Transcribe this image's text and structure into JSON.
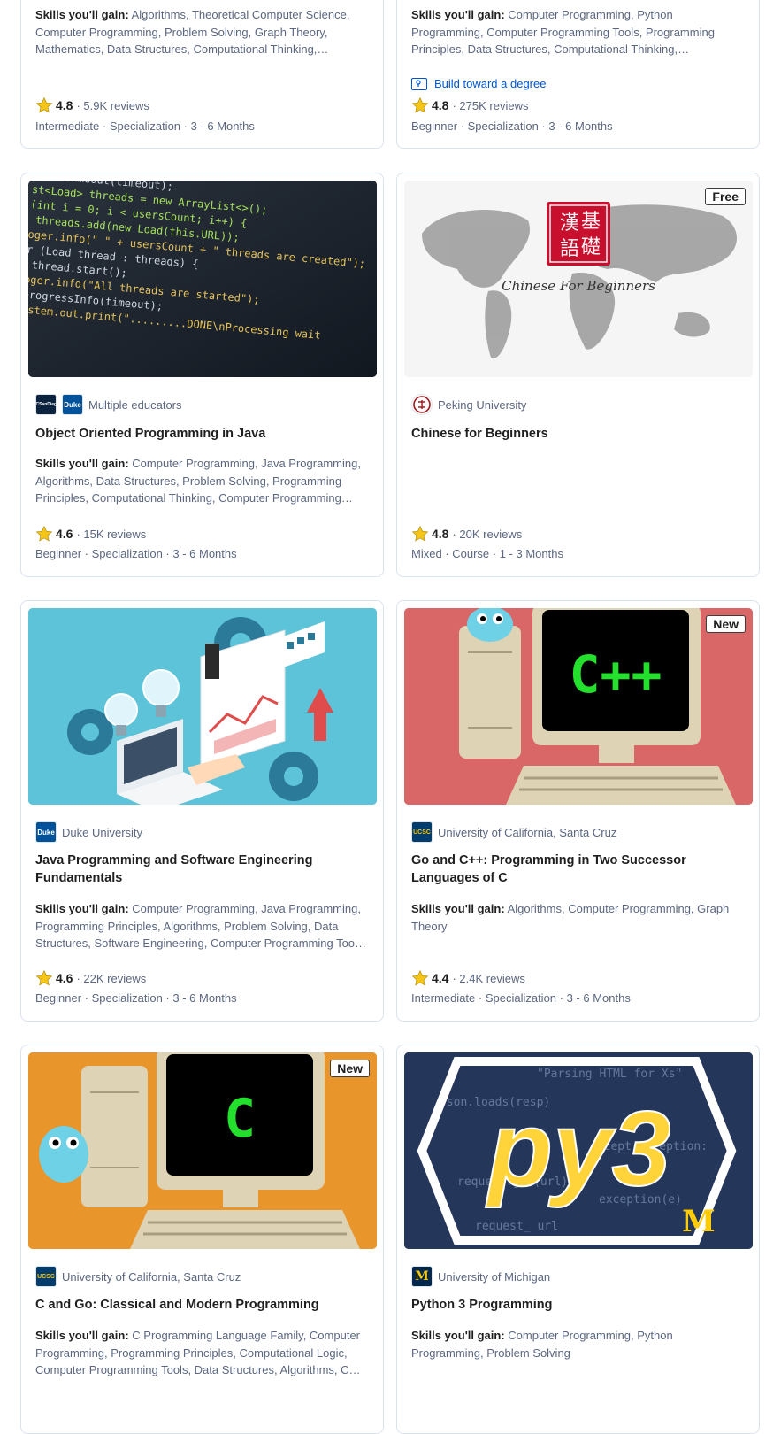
{
  "skills_prefix": "Skills you'll gain:",
  "cards": [
    {
      "skills": "Algorithms, Theoretical Computer Science, Computer Programming, Problem Solving, Graph Theory, Mathematics, Data Structures, Computational Thinking, Computational Logic",
      "rating": "4.8",
      "reviews": "5.9K reviews",
      "meta": "Intermediate · Specialization · 3 - 6 Months"
    },
    {
      "skills": "Computer Programming, Python Programming, Computer Programming Tools, Programming Principles, Data Structures, Computational Thinking, Computational Logic, Data Analysis",
      "degree": "Build toward a degree",
      "rating": "4.8",
      "reviews": "275K reviews",
      "meta": "Beginner · Specialization · 3 - 6 Months"
    },
    {
      "partner": "Multiple educators",
      "title": "Object Oriented Programming in Java",
      "skills": "Computer Programming, Java Programming, Algorithms, Data Structures, Problem Solving, Programming Principles, Computational Thinking, Computer Programming Tools, Software Engineering",
      "rating": "4.6",
      "reviews": "15K reviews",
      "meta": "Beginner · Specialization · 3 - 6 Months"
    },
    {
      "badge": "Free",
      "partner": "Peking University",
      "title": "Chinese for Beginners",
      "rating": "4.8",
      "reviews": "20K reviews",
      "meta": "Mixed · Course · 1 - 3 Months"
    },
    {
      "partner": "Duke University",
      "title": "Java Programming and Software Engineering Fundamentals",
      "skills": "Computer Programming, Java Programming, Programming Principles, Algorithms, Problem Solving, Data Structures, Software Engineering, Computer Programming Tools, Critical Thinking",
      "rating": "4.6",
      "reviews": "22K reviews",
      "meta": "Beginner · Specialization · 3 - 6 Months"
    },
    {
      "badge": "New",
      "partner": "University of California, Santa Cruz",
      "title": "Go and C++: Programming in Two Successor Languages of C",
      "skills": "Algorithms, Computer Programming, Graph Theory",
      "rating": "4.4",
      "reviews": "2.4K reviews",
      "meta": "Intermediate · Specialization · 3 - 6 Months"
    },
    {
      "badge": "New",
      "partner": "University of California, Santa Cruz",
      "title": "C and Go: Classical and Modern Programming",
      "skills": "C Programming Language Family, Computer Programming, Programming Principles, Computational Logic, Computer Programming Tools, Data Structures, Algorithms, C++ Programming"
    },
    {
      "partner": "University of Michigan",
      "title": "Python 3 Programming",
      "skills": "Computer Programming, Python Programming, Problem Solving"
    }
  ],
  "thumb_text": {
    "chinese_caption": "Chinese For Beginners",
    "cpp_screen": "C++",
    "c_screen": "C",
    "py_logo": "py3",
    "py_m": "M",
    "java_code": [
      "d.setTimeout(timeout);",
      "st<Load> threads = new ArrayList<>();",
      "(int i = 0; i < usersCount; i++) {",
      "  threads.add(new Load(this.URL));",
      "",
      "oger.info(\" \" + usersCount + \" threads are created\");",
      "r (Load thread : threads) {",
      "  thread.start();",
      "",
      "oger.info(\"All threads are started\");",
      "progressInfo(timeout);",
      "ystem.out.print(\".........DONE\\nProcessing wait"
    ]
  },
  "logos": {
    "ucsd": "UCSanDiego",
    "duke": "Duke",
    "ucsc": "UCSC",
    "michigan": "M"
  },
  "colors": {
    "link": "#0056d2",
    "star": "#f5c518",
    "card_border": "#dbe3ef",
    "muted_text": "#5b6780"
  }
}
